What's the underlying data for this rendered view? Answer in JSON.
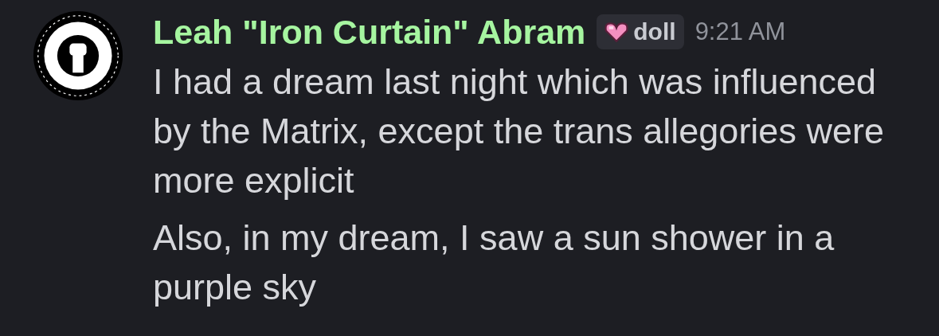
{
  "message_group": {
    "author": {
      "name": "Leah \"Iron Curtain\" Abram",
      "color": "#a6f5a0"
    },
    "tag": {
      "label": "doll"
    },
    "timestamp": "9:21 AM",
    "messages": [
      "I had a dream last night which was influenced by the Matrix, except the trans allegories were more explicit",
      "Also, in my dream, I saw a sun shower in a purple sky"
    ]
  }
}
